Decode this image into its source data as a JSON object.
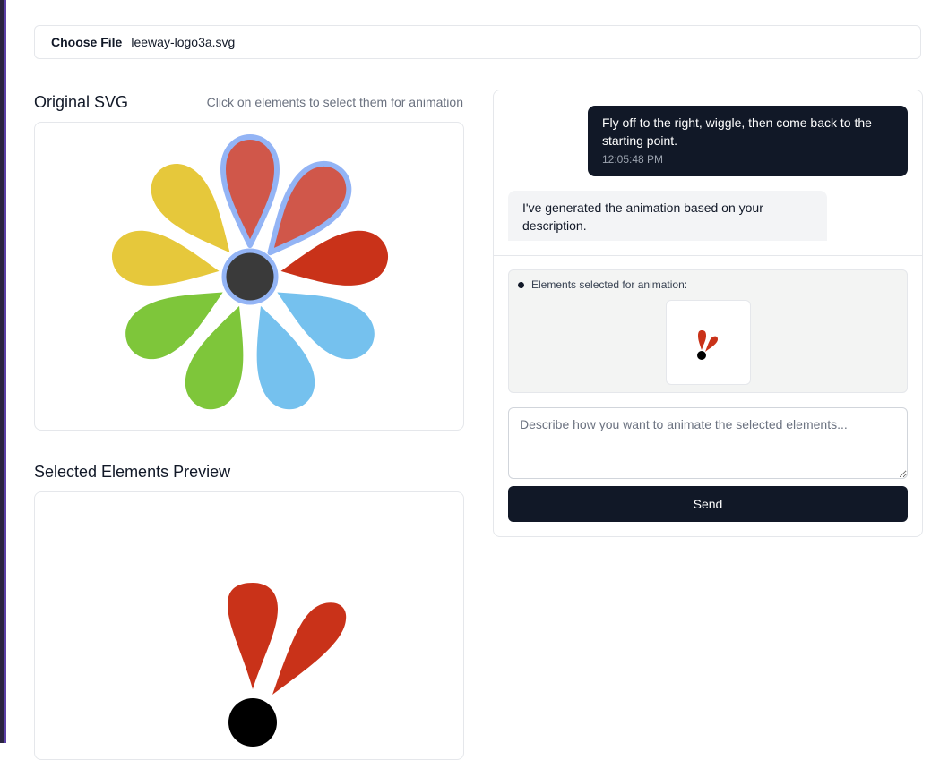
{
  "file_input": {
    "button_label": "Choose File",
    "file_name": "leeway-logo3a.svg"
  },
  "original_svg": {
    "title": "Original SVG",
    "hint": "Click on elements to select them for animation",
    "petal_colors": [
      "#d0574a",
      "#d0574a",
      "#c93219",
      "#75c1ee",
      "#7ec63a",
      "#7ec63a",
      "#7ec63a",
      "#e6c83b",
      "#e6c83b"
    ],
    "center_color": "#3a3a3a",
    "selection_color": "#93b4f5"
  },
  "preview": {
    "title": "Selected Elements Preview",
    "petal_color": "#c93219",
    "center_color": "#000000"
  },
  "chat": {
    "user_message": {
      "text": "Fly off to the right, wiggle, then come back to the starting point.",
      "time": "12:05:48 PM"
    },
    "bot_message": {
      "text": "I've generated the animation based on your description."
    },
    "selected_label": "Elements selected for animation:",
    "input_placeholder": "Describe how you want to animate the selected elements...",
    "send_label": "Send"
  }
}
